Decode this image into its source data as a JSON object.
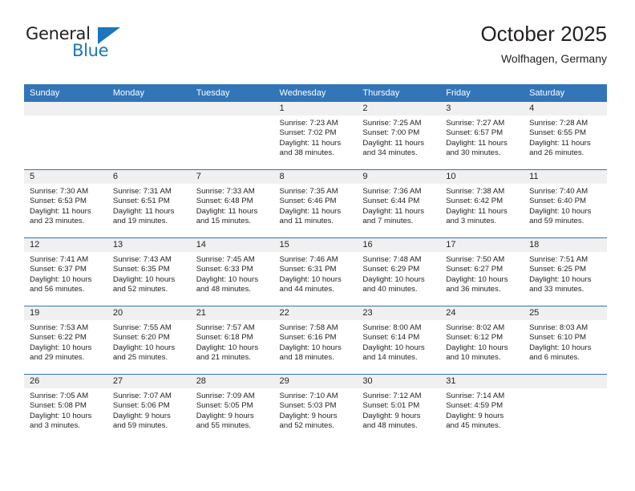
{
  "brand": {
    "name_part1": "General",
    "name_part2": "Blue",
    "accent_color": "#1b76bc",
    "triangle_icon": "triangle-icon"
  },
  "header": {
    "title": "October 2025",
    "subtitle": "Wolfhagen, Germany"
  },
  "theme": {
    "header_blue": "#3275b8",
    "daynum_band": "#f0f0f0",
    "text": "#231f20"
  },
  "weekdays": [
    "Sunday",
    "Monday",
    "Tuesday",
    "Wednesday",
    "Thursday",
    "Friday",
    "Saturday"
  ],
  "weeks": [
    [
      {
        "day": "",
        "empty": true,
        "lines": []
      },
      {
        "day": "",
        "empty": true,
        "lines": []
      },
      {
        "day": "",
        "empty": true,
        "lines": []
      },
      {
        "day": "1",
        "lines": [
          "Sunrise: 7:23 AM",
          "Sunset: 7:02 PM",
          "Daylight: 11 hours",
          "and 38 minutes."
        ]
      },
      {
        "day": "2",
        "lines": [
          "Sunrise: 7:25 AM",
          "Sunset: 7:00 PM",
          "Daylight: 11 hours",
          "and 34 minutes."
        ]
      },
      {
        "day": "3",
        "lines": [
          "Sunrise: 7:27 AM",
          "Sunset: 6:57 PM",
          "Daylight: 11 hours",
          "and 30 minutes."
        ]
      },
      {
        "day": "4",
        "lines": [
          "Sunrise: 7:28 AM",
          "Sunset: 6:55 PM",
          "Daylight: 11 hours",
          "and 26 minutes."
        ]
      }
    ],
    [
      {
        "day": "5",
        "lines": [
          "Sunrise: 7:30 AM",
          "Sunset: 6:53 PM",
          "Daylight: 11 hours",
          "and 23 minutes."
        ]
      },
      {
        "day": "6",
        "lines": [
          "Sunrise: 7:31 AM",
          "Sunset: 6:51 PM",
          "Daylight: 11 hours",
          "and 19 minutes."
        ]
      },
      {
        "day": "7",
        "lines": [
          "Sunrise: 7:33 AM",
          "Sunset: 6:48 PM",
          "Daylight: 11 hours",
          "and 15 minutes."
        ]
      },
      {
        "day": "8",
        "lines": [
          "Sunrise: 7:35 AM",
          "Sunset: 6:46 PM",
          "Daylight: 11 hours",
          "and 11 minutes."
        ]
      },
      {
        "day": "9",
        "lines": [
          "Sunrise: 7:36 AM",
          "Sunset: 6:44 PM",
          "Daylight: 11 hours",
          "and 7 minutes."
        ]
      },
      {
        "day": "10",
        "lines": [
          "Sunrise: 7:38 AM",
          "Sunset: 6:42 PM",
          "Daylight: 11 hours",
          "and 3 minutes."
        ]
      },
      {
        "day": "11",
        "lines": [
          "Sunrise: 7:40 AM",
          "Sunset: 6:40 PM",
          "Daylight: 10 hours",
          "and 59 minutes."
        ]
      }
    ],
    [
      {
        "day": "12",
        "lines": [
          "Sunrise: 7:41 AM",
          "Sunset: 6:37 PM",
          "Daylight: 10 hours",
          "and 56 minutes."
        ]
      },
      {
        "day": "13",
        "lines": [
          "Sunrise: 7:43 AM",
          "Sunset: 6:35 PM",
          "Daylight: 10 hours",
          "and 52 minutes."
        ]
      },
      {
        "day": "14",
        "lines": [
          "Sunrise: 7:45 AM",
          "Sunset: 6:33 PM",
          "Daylight: 10 hours",
          "and 48 minutes."
        ]
      },
      {
        "day": "15",
        "lines": [
          "Sunrise: 7:46 AM",
          "Sunset: 6:31 PM",
          "Daylight: 10 hours",
          "and 44 minutes."
        ]
      },
      {
        "day": "16",
        "lines": [
          "Sunrise: 7:48 AM",
          "Sunset: 6:29 PM",
          "Daylight: 10 hours",
          "and 40 minutes."
        ]
      },
      {
        "day": "17",
        "lines": [
          "Sunrise: 7:50 AM",
          "Sunset: 6:27 PM",
          "Daylight: 10 hours",
          "and 36 minutes."
        ]
      },
      {
        "day": "18",
        "lines": [
          "Sunrise: 7:51 AM",
          "Sunset: 6:25 PM",
          "Daylight: 10 hours",
          "and 33 minutes."
        ]
      }
    ],
    [
      {
        "day": "19",
        "lines": [
          "Sunrise: 7:53 AM",
          "Sunset: 6:22 PM",
          "Daylight: 10 hours",
          "and 29 minutes."
        ]
      },
      {
        "day": "20",
        "lines": [
          "Sunrise: 7:55 AM",
          "Sunset: 6:20 PM",
          "Daylight: 10 hours",
          "and 25 minutes."
        ]
      },
      {
        "day": "21",
        "lines": [
          "Sunrise: 7:57 AM",
          "Sunset: 6:18 PM",
          "Daylight: 10 hours",
          "and 21 minutes."
        ]
      },
      {
        "day": "22",
        "lines": [
          "Sunrise: 7:58 AM",
          "Sunset: 6:16 PM",
          "Daylight: 10 hours",
          "and 18 minutes."
        ]
      },
      {
        "day": "23",
        "lines": [
          "Sunrise: 8:00 AM",
          "Sunset: 6:14 PM",
          "Daylight: 10 hours",
          "and 14 minutes."
        ]
      },
      {
        "day": "24",
        "lines": [
          "Sunrise: 8:02 AM",
          "Sunset: 6:12 PM",
          "Daylight: 10 hours",
          "and 10 minutes."
        ]
      },
      {
        "day": "25",
        "lines": [
          "Sunrise: 8:03 AM",
          "Sunset: 6:10 PM",
          "Daylight: 10 hours",
          "and 6 minutes."
        ]
      }
    ],
    [
      {
        "day": "26",
        "lines": [
          "Sunrise: 7:05 AM",
          "Sunset: 5:08 PM",
          "Daylight: 10 hours",
          "and 3 minutes."
        ]
      },
      {
        "day": "27",
        "lines": [
          "Sunrise: 7:07 AM",
          "Sunset: 5:06 PM",
          "Daylight: 9 hours",
          "and 59 minutes."
        ]
      },
      {
        "day": "28",
        "lines": [
          "Sunrise: 7:09 AM",
          "Sunset: 5:05 PM",
          "Daylight: 9 hours",
          "and 55 minutes."
        ]
      },
      {
        "day": "29",
        "lines": [
          "Sunrise: 7:10 AM",
          "Sunset: 5:03 PM",
          "Daylight: 9 hours",
          "and 52 minutes."
        ]
      },
      {
        "day": "30",
        "lines": [
          "Sunrise: 7:12 AM",
          "Sunset: 5:01 PM",
          "Daylight: 9 hours",
          "and 48 minutes."
        ]
      },
      {
        "day": "31",
        "lines": [
          "Sunrise: 7:14 AM",
          "Sunset: 4:59 PM",
          "Daylight: 9 hours",
          "and 45 minutes."
        ]
      },
      {
        "day": "",
        "empty": true,
        "lines": []
      }
    ]
  ]
}
